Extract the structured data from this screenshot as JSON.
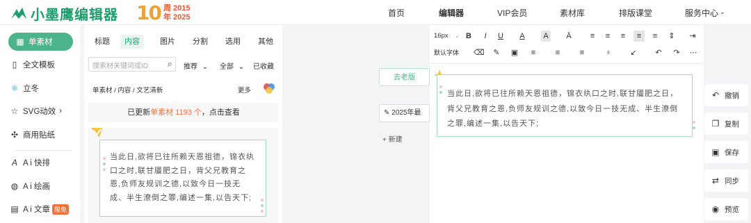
{
  "header": {
    "brand": "小墨鹰编辑器",
    "anniversary_number": "10",
    "anniversary_line1": "周 2015",
    "anniversary_line2": "年 2025",
    "nav": [
      "首页",
      "编辑器",
      "VIP会员",
      "素材库",
      "排版课堂",
      "服务中心"
    ],
    "nav_active": "编辑器",
    "nav_dropdown_icon": "chevron-down-icon"
  },
  "left_nav": {
    "items": [
      {
        "label": "单素材",
        "icon": "grid-icon",
        "active": true
      },
      {
        "label": "全文模板",
        "icon": "template-icon"
      },
      {
        "label": "立冬",
        "icon": "snowflake-icon"
      },
      {
        "label": "SVG动效",
        "icon": "star-icon",
        "chevron": "›"
      },
      {
        "label": "商用贴纸",
        "icon": "puzzle-icon"
      },
      {
        "label": "A i 快排",
        "icon": "ai-icon"
      },
      {
        "label": "A i 绘画",
        "icon": "palette-icon"
      },
      {
        "label": "A i 文章",
        "icon": "document-icon",
        "badge": "限免"
      }
    ]
  },
  "materials": {
    "tabs": [
      "标题",
      "内容",
      "图片",
      "分割",
      "选用",
      "其他"
    ],
    "active_tab": "内容",
    "search_placeholder": "搜索材关键词或ID",
    "filters": [
      {
        "label": "推荐",
        "chevron": "⌄"
      },
      {
        "label": "全部",
        "chevron": "⌄"
      },
      {
        "label": "已收藏"
      }
    ],
    "breadcrumb": "单素材 / 内容 / 文艺清新",
    "more": "更多",
    "update_prefix": "已更新",
    "update_highlight": "单素材 1193 个",
    "update_suffix": "，点击查看",
    "card_poem": "当此日,欲将已往所赖天恩祖德，锦衣纨口之时,联甘餍肥之日，背父兄教育之恩,负师友规训之德,以致今日一技无成、半生潦倒之罪,编述一集,以告天下;"
  },
  "editor": {
    "old_version": "去老版",
    "doc_select": "2025年最",
    "new_button": "新建",
    "toolbar_row1": [
      "16px",
      "B",
      "I",
      "U",
      "A",
      "A",
      "Ā",
      "≡",
      "≡",
      "≡",
      "≡",
      "≡",
      "⇕",
      "⇥"
    ],
    "toolbar_row2": [
      "默认字体",
      "⌫",
      "✎",
      "▣",
      "≡",
      "≡",
      "≡",
      "♀",
      "↙",
      "↶",
      "↷",
      "⋯"
    ],
    "poem": "当此日,欲将已往所赖天恩祖德，锦衣纨口之时,联甘餍肥之日，背父兄教育之恩,负师友规训之德,以致今日一技无成、半生潦倒之罪,编述一集,以告天下;"
  },
  "side_actions": [
    {
      "label": "撤销",
      "icon": "undo-icon"
    },
    {
      "label": "复制",
      "icon": "copy-icon"
    },
    {
      "label": "保存",
      "icon": "save-icon"
    },
    {
      "label": "同步",
      "icon": "sync-icon"
    },
    {
      "label": "预览",
      "icon": "eye-icon"
    }
  ],
  "colors": {
    "brand": "#1f9e6d",
    "accent": "#f0723a",
    "active_nav": "#4cb48a"
  }
}
